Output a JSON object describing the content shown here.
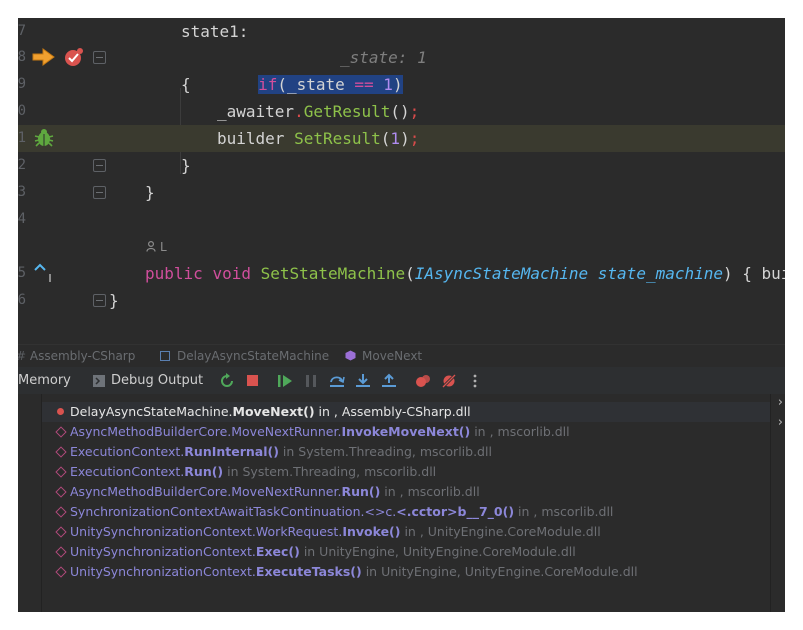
{
  "editor": {
    "line_numbers": [
      "7",
      "8",
      "9",
      "0",
      "1",
      "2",
      "3",
      "4",
      "5",
      "6"
    ],
    "line_state1": "state1:",
    "if_kw": "if",
    "if_open": "(",
    "if_var": "_state",
    "if_op": " == ",
    "if_num": "1",
    "if_close": ")",
    "hint": "_state: 1",
    "open_brace": "{",
    "awaiter_obj": "_awaiter",
    "dot": ".",
    "get_result": "GetResult",
    "parens": "()",
    "semicolon": ";",
    "builder_obj": "builder",
    "set_result": "SetResult",
    "paren_open": "(",
    "set_num": "1",
    "paren_close": ")",
    "close_brace": "}",
    "author_hint": "L",
    "kw_public": "public",
    "kw_void": "void",
    "set_state_machine": "SetStateMachine",
    "param_type": "IAsyncStateMachine",
    "param_name": "state_machine",
    "tail": ") { builder"
  },
  "breadcrumb": {
    "assembly": "Assembly-CSharp",
    "class": "DelayAsyncStateMachine",
    "method": "MoveNext"
  },
  "toolbar": {
    "memory_tab": "Memory",
    "debug_output_tab": "Debug Output"
  },
  "frames": [
    {
      "cls": "DelayAsyncStateMachine.",
      "meth": "MoveNext()",
      "loc": " in , Assembly-CSharp.dll",
      "active": true
    },
    {
      "cls": "AsyncMethodBuilderCore.MoveNextRunner.",
      "meth": "InvokeMoveNext()",
      "loc": " in , mscorlib.dll"
    },
    {
      "cls": "ExecutionContext.",
      "meth": "RunInternal()",
      "loc": " in System.Threading, mscorlib.dll"
    },
    {
      "cls": "ExecutionContext.",
      "meth": "Run()",
      "loc": " in System.Threading, mscorlib.dll"
    },
    {
      "cls": "AsyncMethodBuilderCore.MoveNextRunner.",
      "meth": "Run()",
      "loc": " in , mscorlib.dll"
    },
    {
      "cls": "SynchronizationContextAwaitTaskContinuation.<>c.",
      "meth": "<.cctor>b__7_0()",
      "loc": " in , mscorlib.dll"
    },
    {
      "cls": "UnitySynchronizationContext.WorkRequest.",
      "meth": "Invoke()",
      "loc": " in , UnityEngine.CoreModule.dll"
    },
    {
      "cls": "UnitySynchronizationContext.",
      "meth": "Exec()",
      "loc": " in UnityEngine, UnityEngine.CoreModule.dll"
    },
    {
      "cls": "UnitySynchronizationContext.",
      "meth": "ExecuteTasks()",
      "loc": " in UnityEngine, UnityEngine.CoreModule.dll"
    }
  ],
  "colors": {
    "keyword": "#d04e9c",
    "function": "#8ec24a",
    "type": "#56b7f0",
    "number": "#b08cf0",
    "selection": "#214283",
    "execution_arrow": "#f0a030",
    "breakpoint": "#d9534f",
    "bug_icon": "#5fa83f"
  },
  "icons": [
    "execution-arrow-icon",
    "breakpoint-icon",
    "bug-icon",
    "implements-icon",
    "person-icon",
    "resume-icon",
    "stop-icon",
    "step-over-icon",
    "step-into-icon",
    "step-out-icon",
    "mute-breakpoints-icon",
    "more-icon"
  ]
}
